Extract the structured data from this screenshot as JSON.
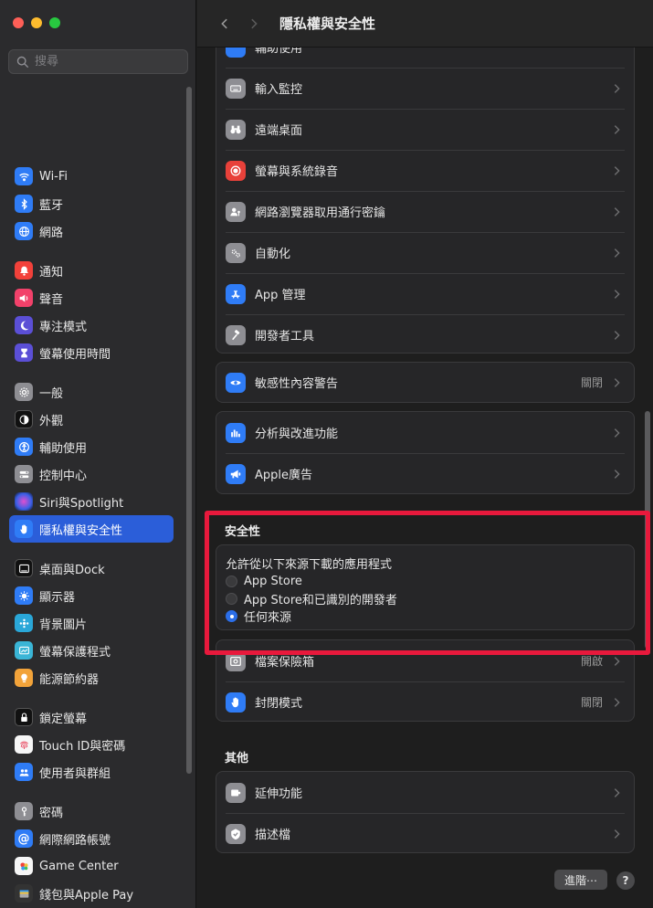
{
  "search": {
    "placeholder": "搜尋"
  },
  "sidebar": {
    "items": [
      {
        "label": "Wi-Fi",
        "icon": "wifi-icon",
        "color": "#2f7cf6"
      },
      {
        "label": "藍牙",
        "icon": "bluetooth-icon",
        "color": "#2f7cf6"
      },
      {
        "label": "網路",
        "icon": "globe-icon",
        "color": "#2f7cf6"
      },
      {
        "label": "通知",
        "icon": "bell-icon",
        "color": "#f2413a"
      },
      {
        "label": "聲音",
        "icon": "speaker-icon",
        "color": "#f2416a"
      },
      {
        "label": "專注模式",
        "icon": "moon-icon",
        "color": "#5b4fd6"
      },
      {
        "label": "螢幕使用時間",
        "icon": "hourglass-icon",
        "color": "#5b4fd6"
      },
      {
        "label": "一般",
        "icon": "gear-icon",
        "color": "#8e8e93"
      },
      {
        "label": "外觀",
        "icon": "appearance-icon",
        "color": "#111111"
      },
      {
        "label": "輔助使用",
        "icon": "accessibility-icon",
        "color": "#2f7cf6"
      },
      {
        "label": "控制中心",
        "icon": "control-center-icon",
        "color": "#8e8e93"
      },
      {
        "label": "Siri與Spotlight",
        "icon": "siri-icon",
        "color": "#7a3cd8"
      },
      {
        "label": "隱私權與安全性",
        "icon": "hand-icon",
        "color": "#2f7cf6"
      },
      {
        "label": "桌面與Dock",
        "icon": "dock-icon",
        "color": "#111111"
      },
      {
        "label": "顯示器",
        "icon": "sun-icon",
        "color": "#2f7cf6"
      },
      {
        "label": "背景圖片",
        "icon": "wallpaper-icon",
        "color": "#2aa7d8"
      },
      {
        "label": "螢幕保護程式",
        "icon": "screensaver-icon",
        "color": "#3ab5d6"
      },
      {
        "label": "能源節約器",
        "icon": "bulb-icon",
        "color": "#f2a33a"
      },
      {
        "label": "鎖定螢幕",
        "icon": "lock-icon",
        "color": "#111111"
      },
      {
        "label": "Touch ID與密碼",
        "icon": "fingerprint-icon",
        "color": "#f6f6f6"
      },
      {
        "label": "使用者與群組",
        "icon": "users-icon",
        "color": "#2f7cf6"
      },
      {
        "label": "密碼",
        "icon": "key-icon",
        "color": "#8e8e93"
      },
      {
        "label": "網際網路帳號",
        "icon": "at-icon",
        "color": "#2f7cf6"
      },
      {
        "label": "Game Center",
        "icon": "game-center-icon",
        "color": "#f6f6f6"
      },
      {
        "label": "錢包與Apple Pay",
        "icon": "wallet-icon",
        "color": "#333333"
      }
    ]
  },
  "header": {
    "title": "隱私權與安全性"
  },
  "privacy_group": {
    "partial_label": "輔助使用",
    "items": [
      {
        "label": "輸入監控",
        "icon": "keyboard-icon",
        "color": "#8e8e93"
      },
      {
        "label": "遠端桌面",
        "icon": "binoculars-icon",
        "color": "#8e8e93"
      },
      {
        "label": "螢幕與系統錄音",
        "icon": "record-icon",
        "color": "#e8413a"
      },
      {
        "label": "網路瀏覽器取用通行密鑰",
        "icon": "person-key-icon",
        "color": "#8e8e93"
      },
      {
        "label": "自動化",
        "icon": "gears-icon",
        "color": "#8e8e93"
      },
      {
        "label": "App 管理",
        "icon": "app-store-icon",
        "color": "#2f7cf6"
      },
      {
        "label": "開發者工具",
        "icon": "hammer-icon",
        "color": "#8e8e93"
      }
    ]
  },
  "sensitive": {
    "label": "敏感性內容警告",
    "value": "關閉",
    "icon": "eye-icon",
    "color": "#2f7cf6"
  },
  "analytics_group": {
    "items": [
      {
        "label": "分析與改進功能",
        "icon": "chart-icon",
        "color": "#2f7cf6"
      },
      {
        "label": "Apple廣告",
        "icon": "megaphone-icon",
        "color": "#2f7cf6"
      }
    ]
  },
  "security": {
    "heading": "安全性",
    "allow_label": "允許從以下來源下載的應用程式",
    "options": [
      {
        "label": "App Store",
        "selected": false
      },
      {
        "label": "App Store和已識別的開發者",
        "selected": false
      },
      {
        "label": "任何來源",
        "selected": true
      }
    ]
  },
  "security_group2": {
    "items": [
      {
        "label": "檔案保險箱",
        "value": "開啟",
        "icon": "filevault-icon",
        "color": "#8e8e93"
      },
      {
        "label": "封閉模式",
        "value": "關閉",
        "icon": "hand-icon",
        "color": "#2f7cf6"
      }
    ]
  },
  "other": {
    "heading": "其他",
    "items": [
      {
        "label": "延伸功能",
        "icon": "extensions-icon",
        "color": "#8e8e93"
      },
      {
        "label": "描述檔",
        "icon": "profile-check-icon",
        "color": "#8e8e93"
      }
    ]
  },
  "footer": {
    "advanced_label": "進階⋯",
    "help_label": "?"
  }
}
